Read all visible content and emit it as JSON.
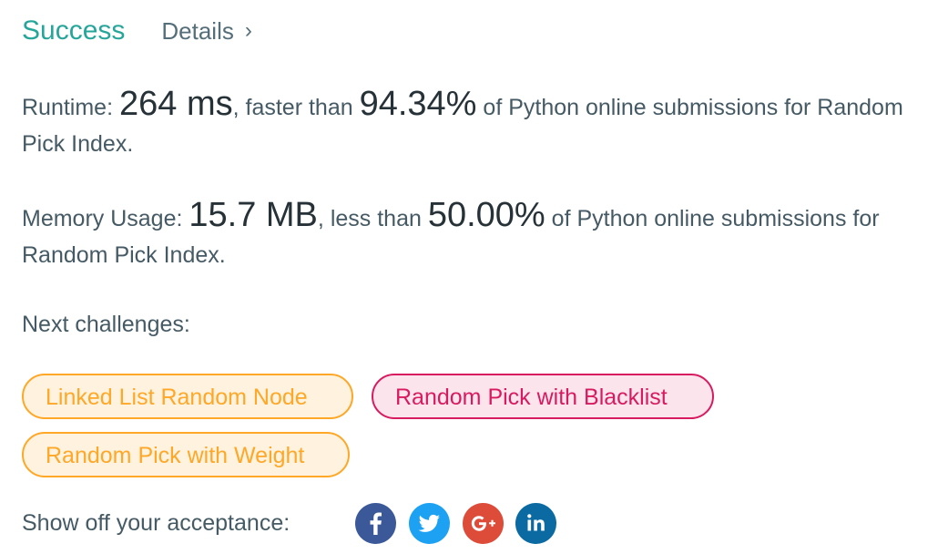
{
  "header": {
    "status": "Success",
    "details_label": "Details",
    "details_chevron": "›"
  },
  "runtime": {
    "label": "Runtime: ",
    "value": "264 ms",
    "mid": ", faster than ",
    "percent": "94.34%",
    "tail": " of Python online submissions for Random Pick Index."
  },
  "memory": {
    "label": "Memory Usage: ",
    "value": "15.7 MB",
    "mid": ", less than ",
    "percent": "50.00%",
    "tail": " of Python online submissions for Random Pick Index."
  },
  "next": {
    "label": "Next challenges:",
    "challenges": [
      {
        "title": "Linked List Random Node",
        "difficulty_color": "#ffa726"
      },
      {
        "title": "Random Pick with Blacklist",
        "difficulty_color": "#d81b60"
      },
      {
        "title": "Random Pick with Weight",
        "difficulty_color": "#ffa726"
      }
    ]
  },
  "share": {
    "label": "Show off your acceptance:",
    "icons": [
      "facebook-icon",
      "twitter-icon",
      "google-plus-icon",
      "linkedin-icon"
    ]
  },
  "colors": {
    "success": "#26a69a",
    "text": "#455a64",
    "facebook": "#3b5998",
    "twitter": "#1da1f2",
    "google_plus": "#dd4b39",
    "linkedin": "#0a6aa1"
  }
}
